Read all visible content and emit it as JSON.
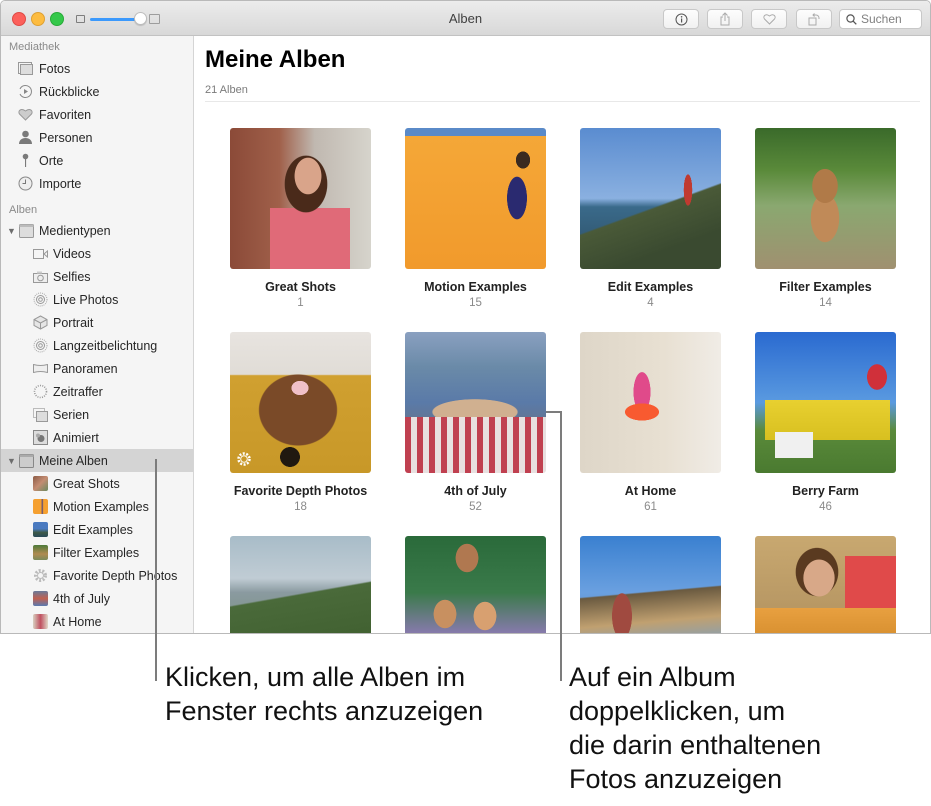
{
  "window": {
    "title": "Alben",
    "toolbar": {
      "info_icon": "info-icon",
      "share_icon": "share-icon",
      "favorite_icon": "heart-icon",
      "rotate_icon": "rotate-icon",
      "search_placeholder": "Suchen",
      "zoom_slider_value": 1.0
    }
  },
  "sidebar": {
    "library_section": "Mediathek",
    "library_items": [
      {
        "label": "Fotos",
        "icon": "photos-icon"
      },
      {
        "label": "Rückblicke",
        "icon": "memories-icon"
      },
      {
        "label": "Favoriten",
        "icon": "heart-icon"
      },
      {
        "label": "Personen",
        "icon": "person-icon"
      },
      {
        "label": "Orte",
        "icon": "pin-icon"
      },
      {
        "label": "Importe",
        "icon": "clock-icon"
      }
    ],
    "albums_section": "Alben",
    "media_types": {
      "label": "Medientypen",
      "items": [
        {
          "label": "Videos",
          "icon": "video-icon"
        },
        {
          "label": "Selfies",
          "icon": "camera-icon"
        },
        {
          "label": "Live Photos",
          "icon": "live-photo-icon"
        },
        {
          "label": "Portrait",
          "icon": "cube-icon"
        },
        {
          "label": "Langzeitbelichtung",
          "icon": "live-photo-icon"
        },
        {
          "label": "Panoramen",
          "icon": "panorama-icon"
        },
        {
          "label": "Zeitraffer",
          "icon": "timelapse-icon"
        },
        {
          "label": "Serien",
          "icon": "burst-icon"
        },
        {
          "label": "Animiert",
          "icon": "animated-icon"
        }
      ]
    },
    "my_albums": {
      "label": "Meine Alben",
      "items": [
        {
          "label": "Great Shots"
        },
        {
          "label": "Motion Examples"
        },
        {
          "label": "Edit Examples"
        },
        {
          "label": "Filter Examples"
        },
        {
          "label": "Favorite Depth Photos"
        },
        {
          "label": "4th of July"
        },
        {
          "label": "At Home"
        }
      ]
    }
  },
  "main": {
    "title": "Meine Alben",
    "count_label": "21 Alben",
    "albums": [
      {
        "name": "Great Shots",
        "count": "1"
      },
      {
        "name": "Motion Examples",
        "count": "15"
      },
      {
        "name": "Edit Examples",
        "count": "4"
      },
      {
        "name": "Filter Examples",
        "count": "14"
      },
      {
        "name": "Favorite Depth Photos",
        "count": "18"
      },
      {
        "name": "4th of July",
        "count": "52"
      },
      {
        "name": "At Home",
        "count": "61"
      },
      {
        "name": "Berry Farm",
        "count": "46"
      },
      {
        "name": "",
        "count": ""
      },
      {
        "name": "",
        "count": ""
      },
      {
        "name": "",
        "count": ""
      },
      {
        "name": "",
        "count": ""
      }
    ]
  },
  "callouts": {
    "left": "Klicken, um alle Alben im\nFenster rechts anzuzeigen",
    "right": "Auf ein Album\ndoppelklicken, um\ndie darin enthaltenen\nFotos anzuzeigen"
  }
}
